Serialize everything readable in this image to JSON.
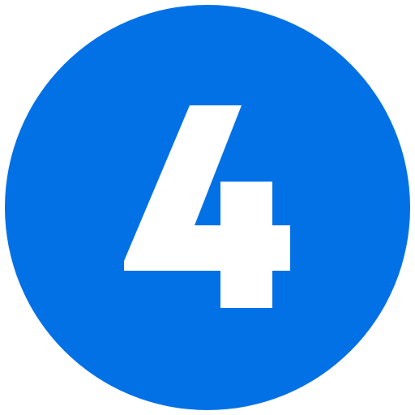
{
  "badge": {
    "number": "4",
    "circle_color": "#0271E6",
    "glyph_color": "#FFFFFF"
  }
}
